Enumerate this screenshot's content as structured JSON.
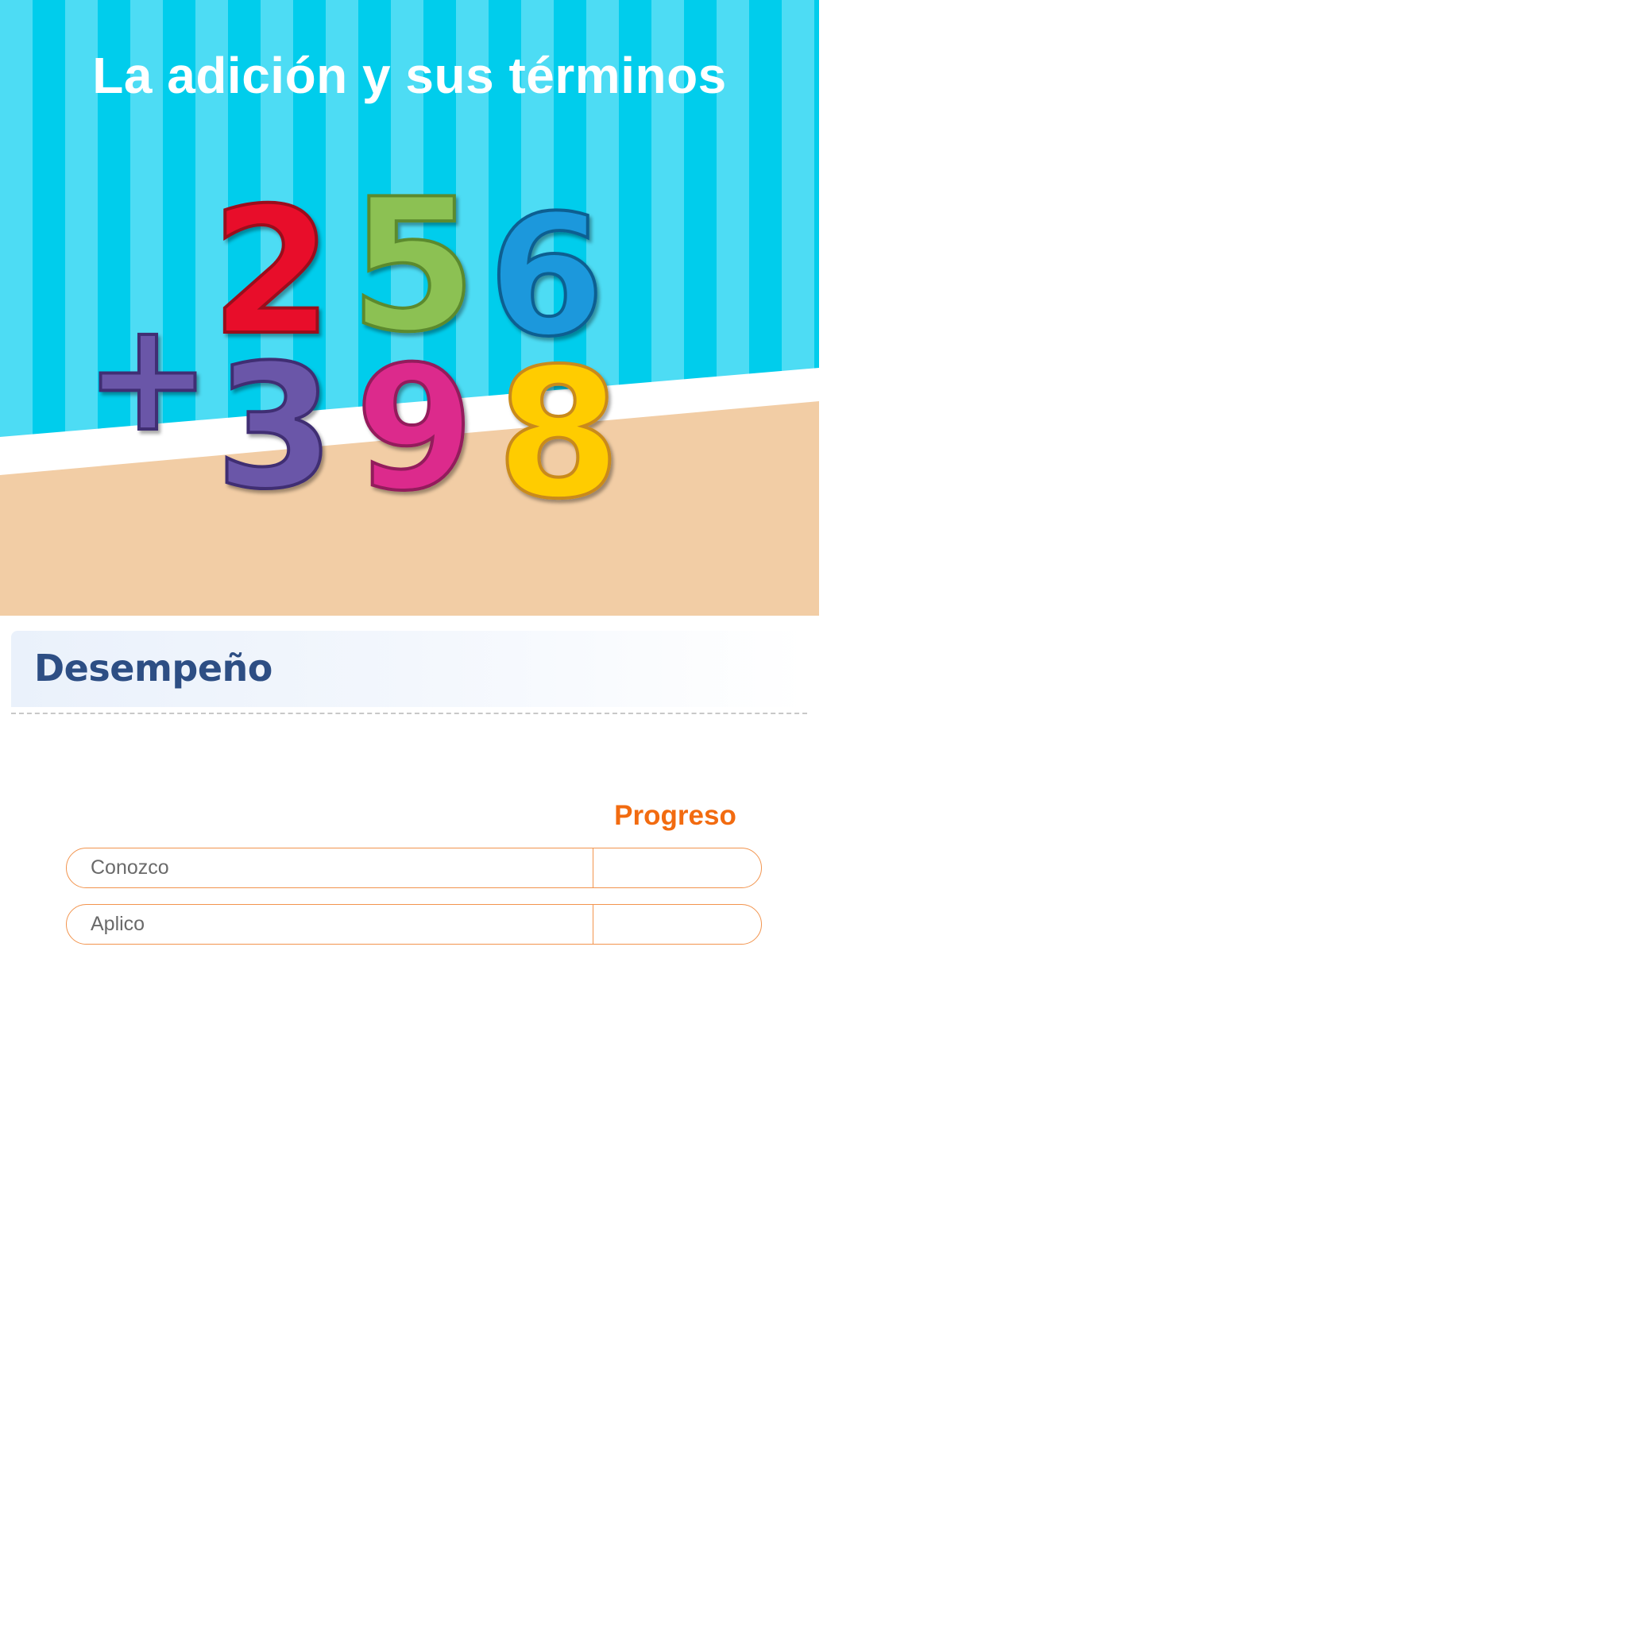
{
  "hero": {
    "title": "La adición y sus términos",
    "digits_top": [
      "2",
      "5",
      "6"
    ],
    "digits_bottom": [
      "+",
      "3",
      "9",
      "8"
    ],
    "colors": {
      "stripe_light": "#4ddcf4",
      "stripe_dark": "#00cdec",
      "floor": "#f2cda5",
      "digit_2": "#e8102a",
      "digit_5": "#8cc152",
      "digit_6": "#1a98dc",
      "digit_plus": "#6a56a8",
      "digit_3": "#6a56a8",
      "digit_9": "#dc2c8c",
      "digit_8": "#ffcc00"
    }
  },
  "section": {
    "title": "Desempeño"
  },
  "progress": {
    "header": "Progreso",
    "rows": [
      {
        "label": "Conozco",
        "value": ""
      },
      {
        "label": "Aplico",
        "value": ""
      }
    ],
    "accent_color": "#f26b10"
  }
}
